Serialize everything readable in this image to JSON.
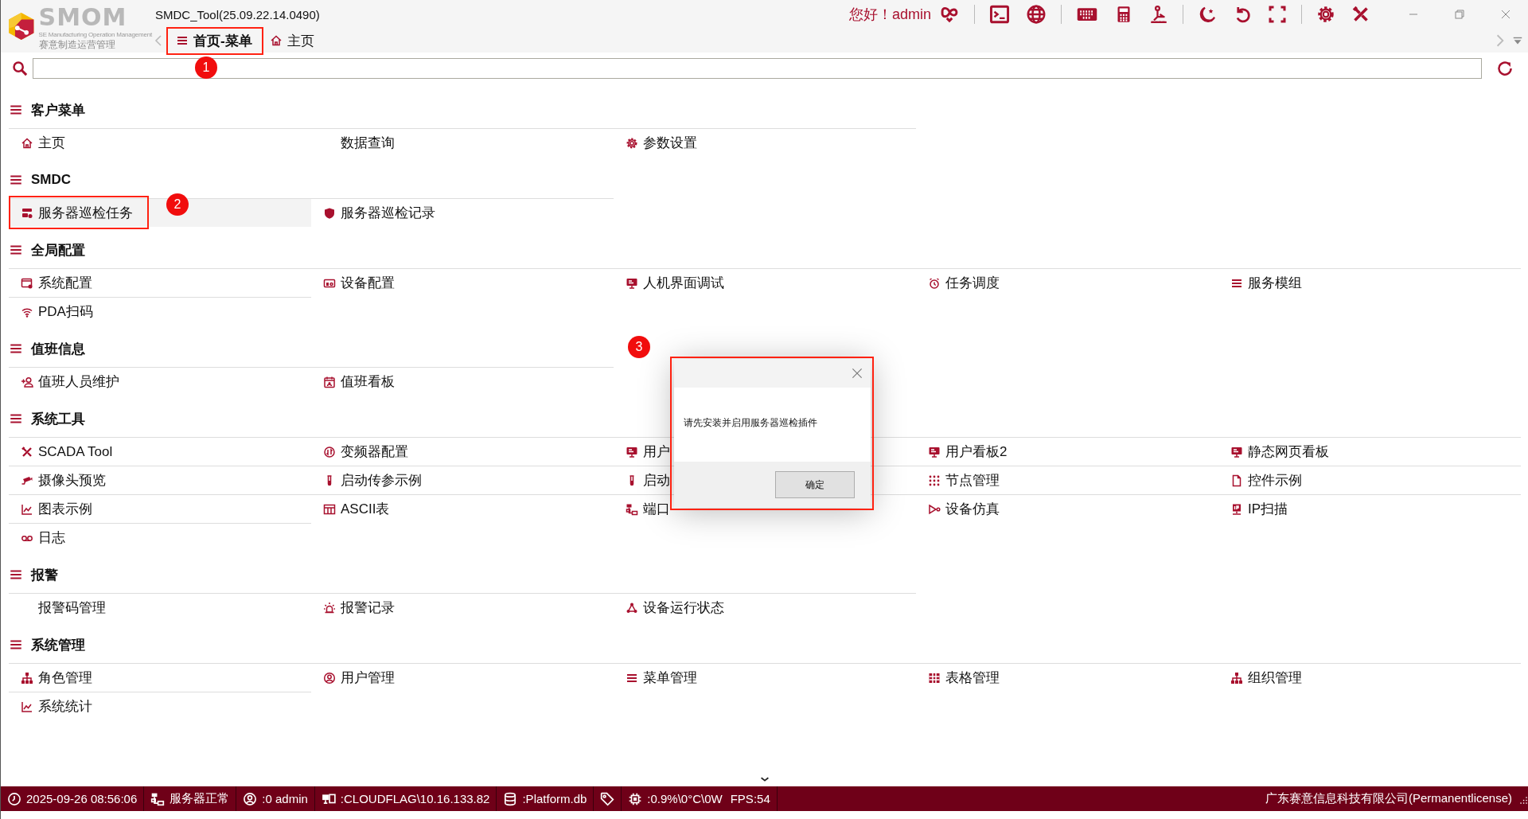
{
  "app": {
    "title": "SMDC_Tool(25.09.22.14.0490)",
    "logo": {
      "name": "SMOM",
      "tagline": "SE Manufacturing Operation Management",
      "subtitle": "赛意制造运营管理"
    },
    "greeting": "您好！admin"
  },
  "tabs": [
    {
      "label": "首页-菜单",
      "selected": true,
      "callout": "1"
    },
    {
      "label": "主页",
      "selected": false
    }
  ],
  "sections": [
    {
      "title": "客户菜单",
      "items": [
        {
          "label": "主页",
          "selected": false
        },
        {
          "label": "数据查询",
          "selected": false
        },
        {
          "label": "参数设置",
          "selected": false
        }
      ]
    },
    {
      "title": "SMDC",
      "items": [
        {
          "label": "服务器巡检任务",
          "selected": true,
          "callout": "2"
        },
        {
          "label": "服务器巡检记录",
          "selected": false
        }
      ]
    },
    {
      "title": "全局配置",
      "items": [
        {
          "label": "系统配置",
          "selected": false
        },
        {
          "label": "设备配置",
          "selected": false
        },
        {
          "label": "人机界面调试",
          "selected": false
        },
        {
          "label": "任务调度",
          "selected": false
        },
        {
          "label": "服务模组",
          "selected": false
        },
        {
          "label": "PDA扫码",
          "selected": false
        }
      ]
    },
    {
      "title": "值班信息",
      "items": [
        {
          "label": "值班人员维护",
          "selected": false
        },
        {
          "label": "值班看板",
          "selected": false
        }
      ]
    },
    {
      "title": "系统工具",
      "items": [
        {
          "label": "SCADA Tool",
          "selected": false
        },
        {
          "label": "变频器配置",
          "selected": false
        },
        {
          "label": "用户",
          "selected": false
        },
        {
          "label": "用户看板2",
          "selected": false
        },
        {
          "label": "静态网页看板",
          "selected": false
        },
        {
          "label": "摄像头预览",
          "selected": false
        },
        {
          "label": "启动传参示例",
          "selected": false
        },
        {
          "label": "启动",
          "selected": false
        },
        {
          "label": "节点管理",
          "selected": false
        },
        {
          "label": "控件示例",
          "selected": false
        },
        {
          "label": "图表示例",
          "selected": false
        },
        {
          "label": "ASCII表",
          "selected": false
        },
        {
          "label": "端口",
          "selected": false
        },
        {
          "label": "设备仿真",
          "selected": false
        },
        {
          "label": "IP扫描",
          "selected": false
        },
        {
          "label": "日志",
          "selected": false
        }
      ]
    },
    {
      "title": "报警",
      "items": [
        {
          "label": "报警码管理",
          "selected": false
        },
        {
          "label": "报警记录",
          "selected": false
        },
        {
          "label": "设备运行状态",
          "selected": false
        }
      ]
    },
    {
      "title": "系统管理",
      "items": [
        {
          "label": "角色管理",
          "selected": false
        },
        {
          "label": "用户管理",
          "selected": false
        },
        {
          "label": "菜单管理",
          "selected": false
        },
        {
          "label": "表格管理",
          "selected": false
        },
        {
          "label": "组织管理",
          "selected": false
        },
        {
          "label": "系统统计",
          "selected": false
        }
      ]
    }
  ],
  "dialog": {
    "message": "请先安装并启用服务器巡检插件",
    "button": "确定",
    "callout": "3"
  },
  "status_bar": {
    "items": [
      {
        "kind": "clock",
        "text": "2025-09-26 08:56:06"
      },
      {
        "kind": "server",
        "text": "服务器正常"
      },
      {
        "kind": "user",
        "text": ":0 admin"
      },
      {
        "kind": "host",
        "text": ":CLOUDFLAG\\10.16.133.82"
      },
      {
        "kind": "database",
        "text": ":Platform.db"
      },
      {
        "kind": "tag"
      },
      {
        "kind": "hardware",
        "text": ":0.9%\\0°C\\0W"
      },
      {
        "kind": "fps",
        "text": "FPS:54"
      }
    ],
    "company": "广东赛意信息科技有限公司(Permanentlicense)"
  }
}
